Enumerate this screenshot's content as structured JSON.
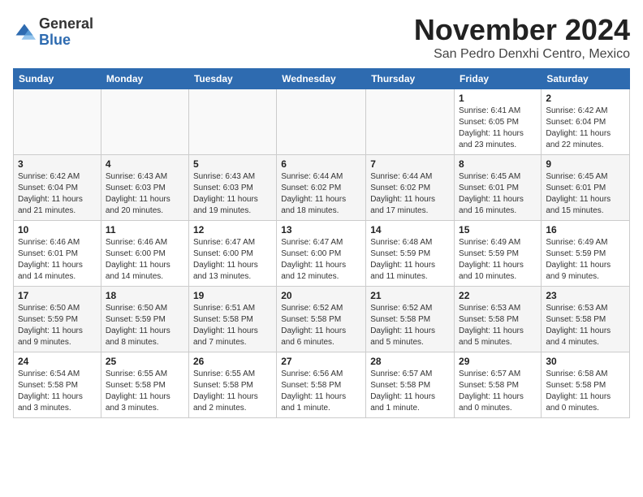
{
  "header": {
    "logo": {
      "general": "General",
      "blue": "Blue"
    },
    "month": "November 2024",
    "location": "San Pedro Denxhi Centro, Mexico"
  },
  "weekdays": [
    "Sunday",
    "Monday",
    "Tuesday",
    "Wednesday",
    "Thursday",
    "Friday",
    "Saturday"
  ],
  "weeks": [
    [
      {
        "day": "",
        "sunrise": "",
        "sunset": "",
        "daylight": ""
      },
      {
        "day": "",
        "sunrise": "",
        "sunset": "",
        "daylight": ""
      },
      {
        "day": "",
        "sunrise": "",
        "sunset": "",
        "daylight": ""
      },
      {
        "day": "",
        "sunrise": "",
        "sunset": "",
        "daylight": ""
      },
      {
        "day": "",
        "sunrise": "",
        "sunset": "",
        "daylight": ""
      },
      {
        "day": "1",
        "sunrise": "Sunrise: 6:41 AM",
        "sunset": "Sunset: 6:05 PM",
        "daylight": "Daylight: 11 hours and 23 minutes."
      },
      {
        "day": "2",
        "sunrise": "Sunrise: 6:42 AM",
        "sunset": "Sunset: 6:04 PM",
        "daylight": "Daylight: 11 hours and 22 minutes."
      }
    ],
    [
      {
        "day": "3",
        "sunrise": "Sunrise: 6:42 AM",
        "sunset": "Sunset: 6:04 PM",
        "daylight": "Daylight: 11 hours and 21 minutes."
      },
      {
        "day": "4",
        "sunrise": "Sunrise: 6:43 AM",
        "sunset": "Sunset: 6:03 PM",
        "daylight": "Daylight: 11 hours and 20 minutes."
      },
      {
        "day": "5",
        "sunrise": "Sunrise: 6:43 AM",
        "sunset": "Sunset: 6:03 PM",
        "daylight": "Daylight: 11 hours and 19 minutes."
      },
      {
        "day": "6",
        "sunrise": "Sunrise: 6:44 AM",
        "sunset": "Sunset: 6:02 PM",
        "daylight": "Daylight: 11 hours and 18 minutes."
      },
      {
        "day": "7",
        "sunrise": "Sunrise: 6:44 AM",
        "sunset": "Sunset: 6:02 PM",
        "daylight": "Daylight: 11 hours and 17 minutes."
      },
      {
        "day": "8",
        "sunrise": "Sunrise: 6:45 AM",
        "sunset": "Sunset: 6:01 PM",
        "daylight": "Daylight: 11 hours and 16 minutes."
      },
      {
        "day": "9",
        "sunrise": "Sunrise: 6:45 AM",
        "sunset": "Sunset: 6:01 PM",
        "daylight": "Daylight: 11 hours and 15 minutes."
      }
    ],
    [
      {
        "day": "10",
        "sunrise": "Sunrise: 6:46 AM",
        "sunset": "Sunset: 6:01 PM",
        "daylight": "Daylight: 11 hours and 14 minutes."
      },
      {
        "day": "11",
        "sunrise": "Sunrise: 6:46 AM",
        "sunset": "Sunset: 6:00 PM",
        "daylight": "Daylight: 11 hours and 14 minutes."
      },
      {
        "day": "12",
        "sunrise": "Sunrise: 6:47 AM",
        "sunset": "Sunset: 6:00 PM",
        "daylight": "Daylight: 11 hours and 13 minutes."
      },
      {
        "day": "13",
        "sunrise": "Sunrise: 6:47 AM",
        "sunset": "Sunset: 6:00 PM",
        "daylight": "Daylight: 11 hours and 12 minutes."
      },
      {
        "day": "14",
        "sunrise": "Sunrise: 6:48 AM",
        "sunset": "Sunset: 5:59 PM",
        "daylight": "Daylight: 11 hours and 11 minutes."
      },
      {
        "day": "15",
        "sunrise": "Sunrise: 6:49 AM",
        "sunset": "Sunset: 5:59 PM",
        "daylight": "Daylight: 11 hours and 10 minutes."
      },
      {
        "day": "16",
        "sunrise": "Sunrise: 6:49 AM",
        "sunset": "Sunset: 5:59 PM",
        "daylight": "Daylight: 11 hours and 9 minutes."
      }
    ],
    [
      {
        "day": "17",
        "sunrise": "Sunrise: 6:50 AM",
        "sunset": "Sunset: 5:59 PM",
        "daylight": "Daylight: 11 hours and 9 minutes."
      },
      {
        "day": "18",
        "sunrise": "Sunrise: 6:50 AM",
        "sunset": "Sunset: 5:59 PM",
        "daylight": "Daylight: 11 hours and 8 minutes."
      },
      {
        "day": "19",
        "sunrise": "Sunrise: 6:51 AM",
        "sunset": "Sunset: 5:58 PM",
        "daylight": "Daylight: 11 hours and 7 minutes."
      },
      {
        "day": "20",
        "sunrise": "Sunrise: 6:52 AM",
        "sunset": "Sunset: 5:58 PM",
        "daylight": "Daylight: 11 hours and 6 minutes."
      },
      {
        "day": "21",
        "sunrise": "Sunrise: 6:52 AM",
        "sunset": "Sunset: 5:58 PM",
        "daylight": "Daylight: 11 hours and 5 minutes."
      },
      {
        "day": "22",
        "sunrise": "Sunrise: 6:53 AM",
        "sunset": "Sunset: 5:58 PM",
        "daylight": "Daylight: 11 hours and 5 minutes."
      },
      {
        "day": "23",
        "sunrise": "Sunrise: 6:53 AM",
        "sunset": "Sunset: 5:58 PM",
        "daylight": "Daylight: 11 hours and 4 minutes."
      }
    ],
    [
      {
        "day": "24",
        "sunrise": "Sunrise: 6:54 AM",
        "sunset": "Sunset: 5:58 PM",
        "daylight": "Daylight: 11 hours and 3 minutes."
      },
      {
        "day": "25",
        "sunrise": "Sunrise: 6:55 AM",
        "sunset": "Sunset: 5:58 PM",
        "daylight": "Daylight: 11 hours and 3 minutes."
      },
      {
        "day": "26",
        "sunrise": "Sunrise: 6:55 AM",
        "sunset": "Sunset: 5:58 PM",
        "daylight": "Daylight: 11 hours and 2 minutes."
      },
      {
        "day": "27",
        "sunrise": "Sunrise: 6:56 AM",
        "sunset": "Sunset: 5:58 PM",
        "daylight": "Daylight: 11 hours and 1 minute."
      },
      {
        "day": "28",
        "sunrise": "Sunrise: 6:57 AM",
        "sunset": "Sunset: 5:58 PM",
        "daylight": "Daylight: 11 hours and 1 minute."
      },
      {
        "day": "29",
        "sunrise": "Sunrise: 6:57 AM",
        "sunset": "Sunset: 5:58 PM",
        "daylight": "Daylight: 11 hours and 0 minutes."
      },
      {
        "day": "30",
        "sunrise": "Sunrise: 6:58 AM",
        "sunset": "Sunset: 5:58 PM",
        "daylight": "Daylight: 11 hours and 0 minutes."
      }
    ]
  ]
}
